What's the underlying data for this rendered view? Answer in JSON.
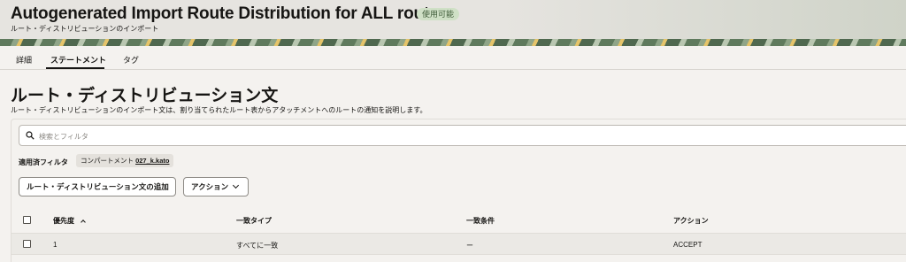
{
  "header": {
    "title": "Autogenerated Import Route Distribution for ALL routes",
    "status_badge": "使用可能",
    "subtitle": "ルート・ディストリビューションのインポート"
  },
  "tabs": [
    {
      "label": "詳細",
      "active": false
    },
    {
      "label": "ステートメント",
      "active": true
    },
    {
      "label": "タグ",
      "active": false
    }
  ],
  "main": {
    "heading": "ルート・ディストリビューション文",
    "description": "ルート・ディストリビューションのインポート文は、割り当てられたルート表からアタッチメントへのルートの通知を説明します。"
  },
  "search": {
    "placeholder": "検索とフィルタ",
    "icon": "search-icon"
  },
  "filters": {
    "label": "適用済フィルタ",
    "chip_key": "コンパートメント",
    "chip_value": "027_k.kato"
  },
  "buttons": {
    "add": "ルート・ディストリビューション文の追加",
    "action": "アクション"
  },
  "table": {
    "columns": [
      "優先度",
      "一致タイプ",
      "一致条件",
      "アクション"
    ],
    "sorted_column": "優先度",
    "rows": [
      {
        "priority": "1",
        "match_type": "すべてに一致",
        "match_criteria": "ー",
        "action": "ACCEPT"
      }
    ]
  }
}
